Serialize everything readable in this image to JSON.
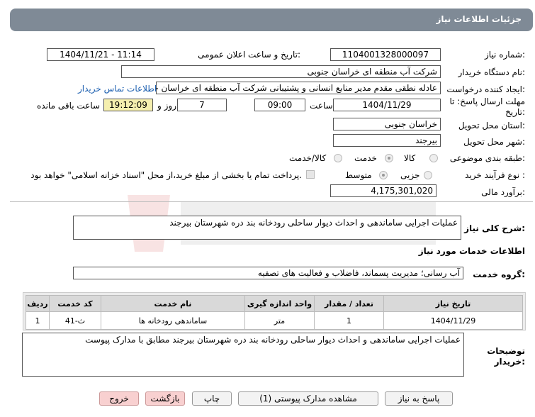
{
  "header": {
    "title": "جزئیات اطلاعات نیاز"
  },
  "form": {
    "need_number_label": "شماره نیاز:",
    "need_number": "1104001328000097",
    "announce_label": "تاریخ و ساعت اعلان عمومی:",
    "announce_value": "1404/11/21 - 11:14",
    "buyer_org_label": "نام دستگاه خریدار:",
    "buyer_org": "شرکت آب منطقه ای خراسان جنوبی",
    "creator_label": "ایجاد کننده درخواست:",
    "creator": "عادله نطقی مقدم مدیر منابع انسانی و پشتیبانی شرکت آب منطقه ای خراسان جنوبی",
    "contact_link": "اطلاعات تماس خریدار",
    "deadline_label": "مهلت ارسال پاسخ: تا تاریخ:",
    "deadline_date": "1404/11/29",
    "time_label": "ساعت",
    "deadline_time": "09:00",
    "days_value": "7",
    "days_label": "روز و",
    "remaining_time": "19:12:09",
    "remaining_label": "ساعت باقی مانده",
    "province_label": "استان محل تحویل:",
    "province": "خراسان جنوبی",
    "city_label": "شهر محل تحویل:",
    "city": "بیرجند",
    "category_label": "طبقه بندی موضوعی:",
    "category_options": [
      "کالا",
      "خدمت",
      "کالا/خدمت"
    ],
    "process_label": "نوع فرآیند خرید :",
    "process_options": [
      "جزیی",
      "متوسط"
    ],
    "payment_note": "پرداخت تمام یا بخشی از مبلغ خرید،از محل \"اسناد خزانه اسلامی\" خواهد بود.",
    "estimate_label": "برآورد مالی:",
    "estimate": "4,175,301,020"
  },
  "summary": {
    "label": "شرح کلی نیاز:",
    "text": "عملیات اجرایی ساماندهی و احداث دیوار ساحلی رودخانه بند دره شهرستان بیرجند"
  },
  "services": {
    "title": "اطلاعات خدمات مورد نیاز",
    "group_label": "گروه خدمت:",
    "group_value": "آب رسانی؛ مدیریت پسماند، فاضلاب و فعالیت های تصفیه",
    "columns": [
      "ردیف",
      "کد خدمت",
      "نام خدمت",
      "واحد اندازه گیری",
      "تعداد / مقدار",
      "تاریخ نیاز"
    ],
    "rows": [
      [
        "1",
        "ث-41",
        "ساماندهی رودخانه ها",
        "متر",
        "1",
        "1404/11/29"
      ]
    ]
  },
  "notes": {
    "label_line1": "توضیحات",
    "label_line2": "خریدار:",
    "text": "عملیات اجرایی ساماندهی و احداث دیوار ساحلی رودخانه بند دره شهرستان بیرجند مطابق با مدارک پیوست"
  },
  "buttons": {
    "reply": "پاسخ به نیاز",
    "attachments": "مشاهده مدارک پیوستی (1)",
    "print": "چاپ",
    "back": "بازگشت",
    "exit": "خروج"
  },
  "colors": {
    "header_bg": "#7f8a96",
    "link": "#1c5fb0",
    "highlight": "#f5efaf",
    "danger_btn": "#f8d0d0"
  }
}
